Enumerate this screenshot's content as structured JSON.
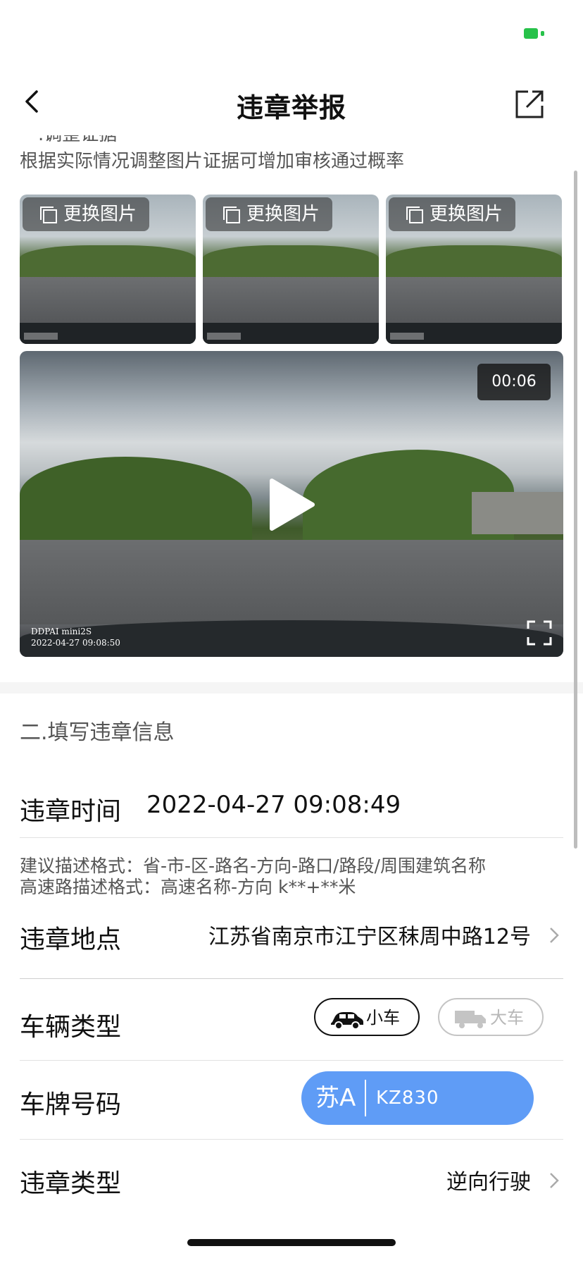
{
  "status_bar": {
    "battery_icon": "battery-charging-icon",
    "battery_color": "#27c24a"
  },
  "nav": {
    "title": "违章举报",
    "back_icon": "chevron-left-icon",
    "share_icon": "share-icon"
  },
  "evidence": {
    "hint": "根据实际情况调整图片证据可增加审核通过概率",
    "thumbnails": [
      {
        "action_label": "更换图片"
      },
      {
        "action_label": "更换图片"
      },
      {
        "action_label": "更换图片"
      }
    ],
    "video": {
      "duration": "00:06",
      "watermark_brand": "DDPAI mini2S",
      "watermark_time": "2022-04-27  09:08:50"
    }
  },
  "form": {
    "section_title": "二.填写违章信息",
    "time": {
      "label": "违章时间",
      "value": "2022-04-27 09:08:49"
    },
    "location_hint_1": "建议描述格式：省-市-区-路名-方向-路口/路段/周围建筑名称",
    "location_hint_2": "高速路描述格式：高速名称-方向 k**+**米",
    "location": {
      "label": "违章地点",
      "value": "江苏省南京市江宁区秣周中路12号"
    },
    "vehicle_type": {
      "label": "车辆类型",
      "options": [
        "小车",
        "大车"
      ],
      "selected": "小车"
    },
    "plate": {
      "label": "车牌号码",
      "province": "苏A",
      "number": "KZ830",
      "color": "#5f9cf6"
    },
    "violation_type": {
      "label": "违章类型",
      "value": "逆向行驶"
    }
  }
}
